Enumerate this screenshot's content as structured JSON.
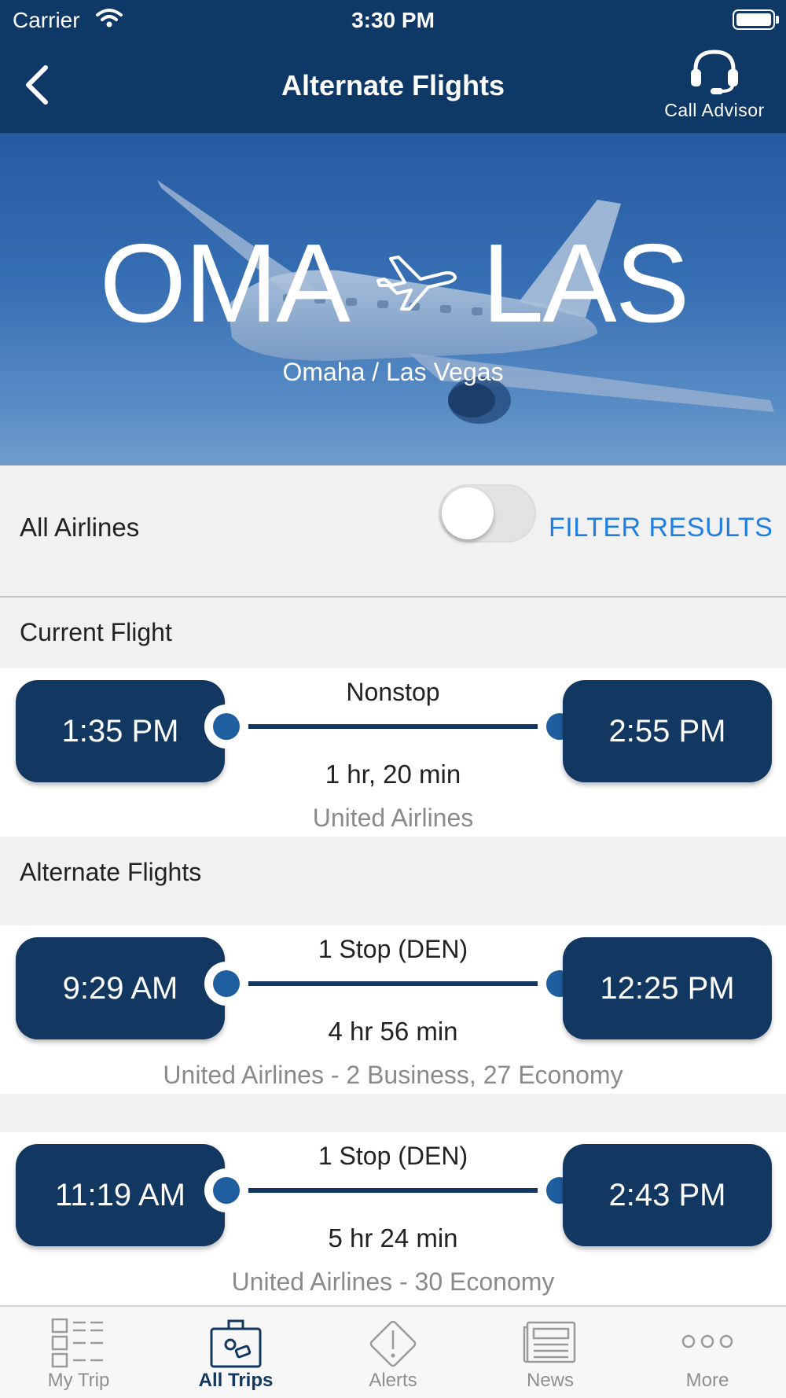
{
  "status_bar": {
    "carrier": "Carrier",
    "time": "3:30 PM"
  },
  "nav": {
    "title": "Alternate Flights",
    "call_advisor": "Call Advisor"
  },
  "route": {
    "origin": "OMA",
    "destination": "LAS",
    "cities": "Omaha / Las Vegas"
  },
  "filter": {
    "label": "All Airlines",
    "toggle_on": false,
    "filter_button": "FILTER RESULTS"
  },
  "current_section": "Current Flight",
  "current_flight": {
    "depart": "1:35 PM",
    "arrive": "2:55 PM",
    "stops": "Nonstop",
    "duration": "1 hr, 20 min",
    "airline": "United Airlines"
  },
  "alternate_section": "Alternate Flights",
  "alternates": [
    {
      "depart": "9:29 AM",
      "arrive": "12:25 PM",
      "stops": "1 Stop (DEN)",
      "duration": "4 hr 56 min",
      "airline": "United Airlines - 2 Business, 27 Economy"
    },
    {
      "depart": "11:19 AM",
      "arrive": "2:43 PM",
      "stops": "1 Stop (DEN)",
      "duration": "5 hr 24 min",
      "airline": "United Airlines - 30 Economy"
    }
  ],
  "tabs": [
    {
      "label": "My Trip",
      "icon": "trip-list-icon",
      "active": false
    },
    {
      "label": "All Trips",
      "icon": "suitcase-icon",
      "active": true
    },
    {
      "label": "Alerts",
      "icon": "alert-icon",
      "active": false
    },
    {
      "label": "News",
      "icon": "newspaper-icon",
      "active": false
    },
    {
      "label": "More",
      "icon": "more-icon",
      "active": false
    }
  ],
  "colors": {
    "nav_bg": "#0e3866",
    "pill_bg": "#123760",
    "accent": "#1f7fe0",
    "dot": "#1e5d9e"
  }
}
